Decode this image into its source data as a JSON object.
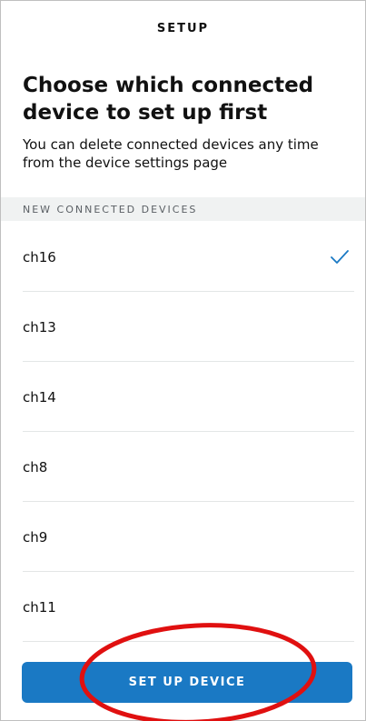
{
  "header": {
    "title": "SETUP"
  },
  "page": {
    "heading": "Choose which connected device to set up first",
    "subtitle": "You can delete connected devices any time from the device settings page"
  },
  "section": {
    "label": "NEW CONNECTED DEVICES"
  },
  "devices": [
    {
      "name": "ch16",
      "selected": true
    },
    {
      "name": "ch13",
      "selected": false
    },
    {
      "name": "ch14",
      "selected": false
    },
    {
      "name": "ch8",
      "selected": false
    },
    {
      "name": "ch9",
      "selected": false
    },
    {
      "name": "ch11",
      "selected": false
    }
  ],
  "footer": {
    "button_label": "SET UP DEVICE"
  },
  "colors": {
    "accent": "#1a79c4",
    "check": "#1a79c4",
    "annotation": "#e01010"
  },
  "icons": {
    "selected": "checkmark-icon"
  }
}
